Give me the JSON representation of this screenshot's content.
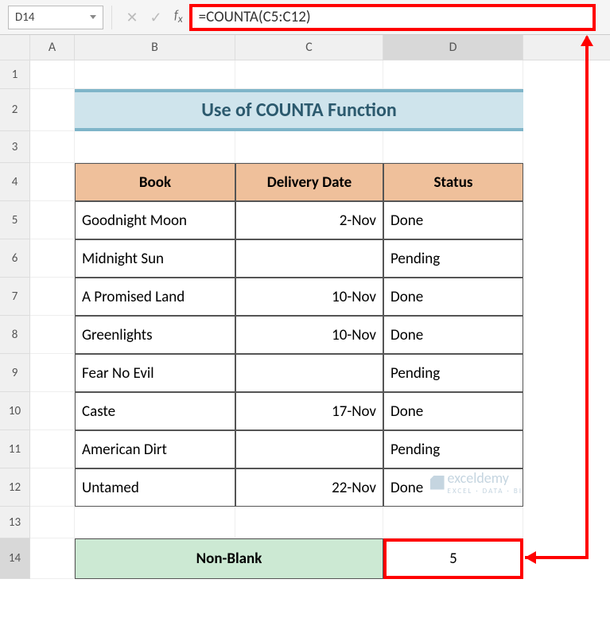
{
  "nameBox": "D14",
  "formula": "=COUNTA(C5:C12)",
  "columns": {
    "A": "A",
    "B": "B",
    "C": "C",
    "D": "D"
  },
  "rows": [
    "1",
    "2",
    "3",
    "4",
    "5",
    "6",
    "7",
    "8",
    "9",
    "10",
    "11",
    "12",
    "13",
    "14"
  ],
  "title": "Use of COUNTA Function",
  "headers": {
    "book": "Book",
    "date": "Delivery Date",
    "status": "Status"
  },
  "data": [
    {
      "book": "Goodnight Moon",
      "date": "2-Nov",
      "status": "Done"
    },
    {
      "book": "Midnight Sun",
      "date": "",
      "status": "Pending"
    },
    {
      "book": "A Promised Land",
      "date": "10-Nov",
      "status": "Done"
    },
    {
      "book": "Greenlights",
      "date": "10-Nov",
      "status": "Done"
    },
    {
      "book": "Fear No Evil",
      "date": "",
      "status": "Pending"
    },
    {
      "book": "Caste",
      "date": "17-Nov",
      "status": "Done"
    },
    {
      "book": "American Dirt",
      "date": "",
      "status": "Pending"
    },
    {
      "book": "Untamed",
      "date": "22-Nov",
      "status": "Done"
    }
  ],
  "nonBlank": {
    "label": "Non-Blank",
    "value": "5"
  },
  "watermark": {
    "text": "exceldemy",
    "sub": "EXCEL · DATA · BI"
  }
}
